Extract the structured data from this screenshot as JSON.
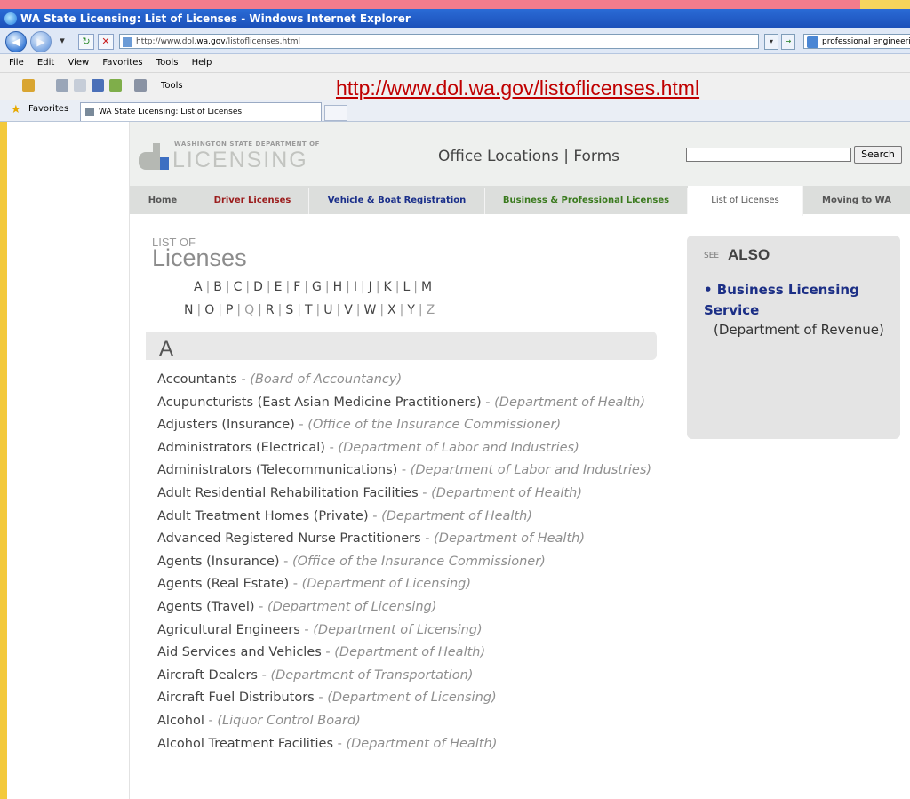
{
  "window": {
    "title": "WA State Licensing: List of Licenses - Windows Internet Explorer"
  },
  "address": {
    "prefix": "http://www.dol.",
    "host": "wa.gov",
    "path": "/listoflicenses.html"
  },
  "search_provider": {
    "value": "professional engineering"
  },
  "menu": {
    "items": [
      "File",
      "Edit",
      "View",
      "Favorites",
      "Tools",
      "Help"
    ]
  },
  "command": {
    "tools_label": "Tools"
  },
  "overlay": {
    "url": "http://www.dol.wa.gov/listoflicenses.html"
  },
  "favorites": {
    "label": "Favorites",
    "tab_title": "WA State Licensing: List of Licenses"
  },
  "site": {
    "logo_small": "WASHINGTON STATE DEPARTMENT OF",
    "logo_big": "LICENSING",
    "top_links": [
      "Office Locations",
      "|",
      "Forms"
    ],
    "search_button": "Search",
    "nav_tabs": [
      {
        "label": "Home",
        "color": "#555555"
      },
      {
        "label": "Driver Licenses",
        "color": "#9b1c1c"
      },
      {
        "label": "Vehicle & Boat Registration",
        "color": "#1a2f8a"
      },
      {
        "label": "Business & Professional Licenses",
        "color": "#3a7a1e"
      },
      {
        "label": "List of Licenses",
        "color": "#555555"
      },
      {
        "label": "Moving to WA",
        "color": "#555555"
      }
    ]
  },
  "listing": {
    "title_small": "LIST OF",
    "title_big": "Licenses",
    "letters_row1": [
      "A",
      "B",
      "C",
      "D",
      "E",
      "F",
      "G",
      "H",
      "I",
      "J",
      "K",
      "L",
      "M"
    ],
    "letters_row2": [
      "N",
      "O",
      "P",
      "Q",
      "R",
      "S",
      "T",
      "U",
      "V",
      "W",
      "X",
      "Y",
      "Z"
    ],
    "dim_letters": [
      "Q",
      "Z"
    ],
    "section_letter": "A",
    "entries": [
      {
        "name": "Accountants",
        "agency": "(Board of Accountancy)"
      },
      {
        "name": "Acupuncturists (East Asian Medicine Practitioners)",
        "agency": "(Department of Health)"
      },
      {
        "name": "Adjusters (Insurance)",
        "agency": "(Office of the Insurance Commissioner)"
      },
      {
        "name": "Administrators (Electrical)",
        "agency": "(Department of Labor and Industries)"
      },
      {
        "name": "Administrators (Telecommunications)",
        "agency": "(Department of Labor and Industries)"
      },
      {
        "name": "Adult Residential Rehabilitation Facilities",
        "agency": "(Department of Health)"
      },
      {
        "name": "Adult Treatment Homes (Private)",
        "agency": "(Department of Health)"
      },
      {
        "name": "Advanced Registered Nurse Practitioners",
        "agency": "(Department of Health)"
      },
      {
        "name": "Agents (Insurance)",
        "agency": "(Office of the Insurance Commissioner)"
      },
      {
        "name": "Agents (Real Estate)",
        "agency": "(Department of Licensing)"
      },
      {
        "name": "Agents (Travel)",
        "agency": "(Department of Licensing)"
      },
      {
        "name": "Agricultural Engineers",
        "agency": "(Department of Licensing)"
      },
      {
        "name": "Aid Services and Vehicles",
        "agency": "(Department of Health)"
      },
      {
        "name": "Aircraft Dealers",
        "agency": "(Department of Transportation)"
      },
      {
        "name": "Aircraft Fuel Distributors",
        "agency": "(Department of Licensing)"
      },
      {
        "name": "Alcohol",
        "agency": "(Liquor Control Board)"
      },
      {
        "name": "Alcohol Treatment Facilities",
        "agency": "(Department of Health)"
      }
    ]
  },
  "see_also": {
    "small": "SEE",
    "big": "ALSO",
    "link": "• Business Licensing Service",
    "dept": "(Department of Revenue)"
  }
}
